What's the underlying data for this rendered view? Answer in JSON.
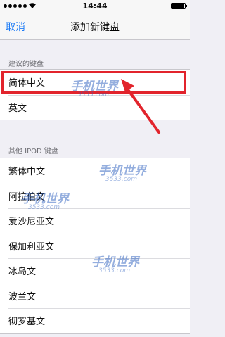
{
  "status_bar": {
    "time": "14:44"
  },
  "nav": {
    "cancel_label": "取消",
    "title": "添加新键盘"
  },
  "suggested": {
    "header": "建议的键盘",
    "items": [
      "简体中文",
      "英文"
    ]
  },
  "other": {
    "header": "其他 IPOD 键盘",
    "items": [
      "繁体中文",
      "阿拉伯文",
      "爱沙尼亚文",
      "保加利亚文",
      "冰岛文",
      "波兰文",
      "彻罗基文"
    ]
  },
  "watermark": {
    "brand": "手机世界",
    "url": "3533.com"
  },
  "colors": {
    "accent": "#1e7cf6",
    "highlight": "#e2242c",
    "arrow": "#e2242c"
  }
}
